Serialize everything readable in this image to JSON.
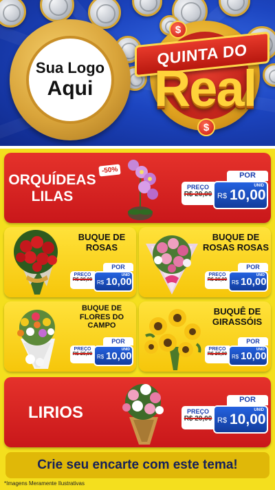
{
  "header": {
    "logo_line1": "Sua Logo",
    "logo_line2": "Aqui",
    "campaign_top": "QUINTA DO",
    "campaign_main": "Real",
    "badge_symbol": "$"
  },
  "colors": {
    "red": "#d2160f",
    "blue": "#1b3fae",
    "yellow": "#f4df1e",
    "gold": "#ffd23a"
  },
  "products": [
    {
      "title_lines": [
        "ORQUÍDEAS",
        "LILAS"
      ],
      "discount": "-50%",
      "price_label": "PREÇO",
      "old_price": "R$ 20,00",
      "por_label": "POR",
      "currency": "R$",
      "price": "10,00",
      "unit": "UNID",
      "image_icon": "orchid-icon"
    },
    {
      "title_lines": [
        "BUQUE DE",
        "ROSAS"
      ],
      "price_label": "PREÇO",
      "old_price": "R$ 20,00",
      "por_label": "POR",
      "currency": "R$",
      "price": "10,00",
      "unit": "UNID",
      "image_icon": "rose-bouquet-icon"
    },
    {
      "title_lines": [
        "BUQUE DE",
        "ROSAS ROSAS"
      ],
      "price_label": "PREÇO",
      "old_price": "R$ 20,00",
      "por_label": "POR",
      "currency": "R$",
      "price": "10,00",
      "unit": "UNID",
      "image_icon": "pink-rose-bouquet-icon"
    },
    {
      "title_lines": [
        "BUQUE DE",
        "FLORES DO",
        "CAMPO"
      ],
      "price_label": "PREÇO",
      "old_price": "R$ 20,00",
      "por_label": "POR",
      "currency": "R$",
      "price": "10,00",
      "unit": "UNID",
      "image_icon": "wildflower-bouquet-icon"
    },
    {
      "title_lines": [
        "BUQUÊ DE",
        "GIRASSÓIS"
      ],
      "price_label": "PREÇO",
      "old_price": "R$ 20,00",
      "por_label": "POR",
      "currency": "R$",
      "price": "10,00",
      "unit": "UNID",
      "image_icon": "sunflower-bouquet-icon"
    },
    {
      "title_lines": [
        "LIRIOS"
      ],
      "price_label": "PREÇO",
      "old_price": "R$ 20,00",
      "por_label": "POR",
      "currency": "R$",
      "price": "10,00",
      "unit": "UNID",
      "image_icon": "lily-bouquet-icon"
    }
  ],
  "footer": {
    "cta": "Crie seu encarte com este tema!",
    "disclaimer": "*Imagens Meramente Ilustrativas"
  }
}
